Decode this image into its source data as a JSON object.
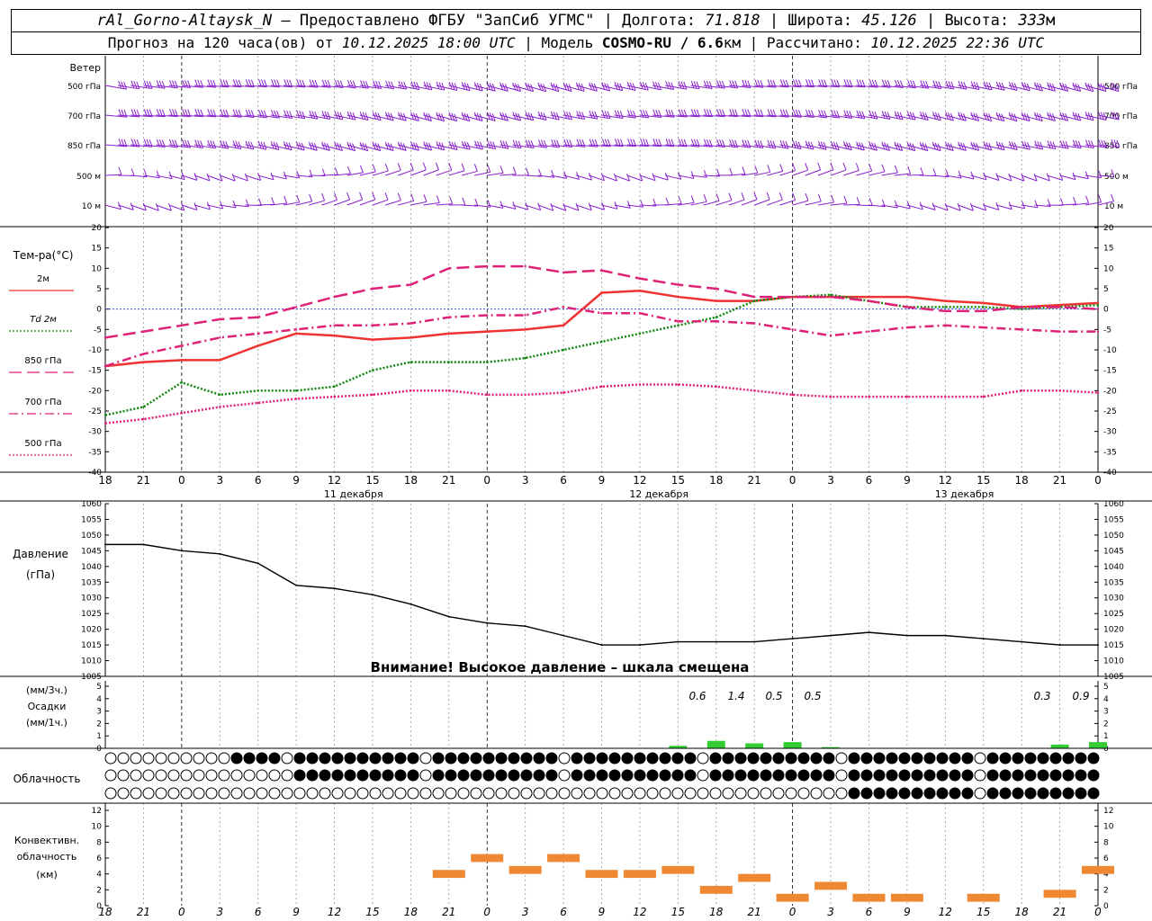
{
  "header": {
    "station": "rAl_Gorno-Altaysk_N",
    "provided_by": "– Предоставлено ФГБУ \"ЗапСиб УГМС\" |",
    "lon_label": "Долгота:",
    "lon": "71.818",
    "lat_label": "| Широта:",
    "lat": "45.126",
    "alt_label": "| Высота:",
    "alt": "333",
    "alt_unit": "м",
    "forecast_label": "Прогноз на 120 часа(ов) от",
    "forecast_from": "10.12.2025 18:00 UTC",
    "model_label": "| Модель",
    "model": "COSMO-RU / 6.6",
    "model_unit": "км",
    "computed_label": "| Рассчитано:",
    "computed": "10.12.2025 22:36 UTC"
  },
  "wind_panel": {
    "title": "Ветер",
    "levels": [
      "500 гПа",
      "700 гПа",
      "850 гПа",
      "500 м",
      "10 м"
    ]
  },
  "temp_panel": {
    "title": "Тем-ра(°С)",
    "legend": [
      {
        "label": "2м",
        "color": "#ee3333",
        "dash": "solid"
      },
      {
        "label": "Td 2м",
        "color": "#118811",
        "dash": "dotted"
      },
      {
        "label": "850 гПа",
        "color": "#dd2277",
        "dash": "long"
      },
      {
        "label": "700 гПа",
        "color": "#dd2277",
        "dash": "dashdot"
      },
      {
        "label": "500 гПа",
        "color": "#dd2277",
        "dash": "dotted"
      }
    ],
    "y_ticks": [
      "20",
      "15",
      "10",
      "5",
      "0",
      "-5",
      "-10",
      "-15",
      "-20",
      "-25",
      "-30",
      "-35",
      "-40"
    ]
  },
  "time_axis": {
    "hour_labels": [
      "18",
      "21",
      "0",
      "3",
      "6",
      "9",
      "12",
      "15",
      "18",
      "21",
      "0",
      "3",
      "6",
      "9",
      "12",
      "15",
      "18",
      "21",
      "0",
      "3",
      "6",
      "9",
      "12",
      "15",
      "18",
      "21",
      "0"
    ],
    "day_labels": [
      "11 декабря",
      "12 декабря",
      "13 декабря"
    ]
  },
  "pressure_panel": {
    "title": "Давление",
    "unit": "(гПа)",
    "y_ticks": [
      "1060",
      "1055",
      "1050",
      "1045",
      "1040",
      "1035",
      "1030",
      "1025",
      "1020",
      "1015",
      "1010",
      "1005"
    ],
    "warning": "Внимание! Высокое давление – шкала смещена"
  },
  "precip_panel": {
    "unit3": "(мм/3ч.)",
    "title": "Осадки",
    "unit1": "(мм/1ч.)",
    "y_ticks": [
      "5",
      "4",
      "3",
      "2",
      "1",
      "0"
    ],
    "totals": [
      "0.6",
      "1.4",
      "0.5",
      "0.5",
      "0.3",
      "0.9"
    ]
  },
  "cloud_panel": {
    "title": "Облачность"
  },
  "conv_panel": {
    "title1": "Конвективн.",
    "title2": "облачность",
    "unit": "(км)",
    "y_ticks": [
      "12",
      "10",
      "8",
      "6",
      "4",
      "2",
      "0"
    ]
  },
  "colors": {
    "wind": "#8822cc",
    "t2m": "#ee3333",
    "td": "#118811",
    "upper": "#dd2277",
    "zero_line": "#3344ee",
    "precip": "#33cc33",
    "conv": "#ee8833"
  },
  "chart_data": [
    {
      "type": "line",
      "title": "Тем-ра(°С)",
      "x": [
        "18",
        "21",
        "0",
        "3",
        "6",
        "9",
        "12",
        "15",
        "18",
        "21",
        "0",
        "3",
        "6",
        "9",
        "12",
        "15",
        "18",
        "21",
        "0",
        "3",
        "6",
        "9",
        "12",
        "15",
        "18",
        "21",
        "0"
      ],
      "ylim": [
        -40,
        20
      ],
      "series": [
        {
          "name": "2м",
          "values": [
            -14,
            -13,
            -12.5,
            -12.5,
            -9,
            -6,
            -6.5,
            -7.5,
            -7,
            -6,
            -5.5,
            -5,
            -4,
            4,
            4.5,
            3,
            2,
            2,
            3,
            3,
            3,
            3,
            2,
            1.5,
            0.5,
            1,
            1.5
          ]
        },
        {
          "name": "Td 2м",
          "values": [
            -26,
            -24,
            -18,
            -21,
            -20,
            -20,
            -19,
            -15,
            -13,
            -13,
            -13,
            -12,
            -10,
            -8,
            -6,
            -4,
            -2,
            2,
            3,
            3.5,
            2,
            0.5,
            0.5,
            0.5,
            0,
            0.5,
            1
          ]
        },
        {
          "name": "850 гПа",
          "values": [
            -7,
            -5.5,
            -4,
            -2.5,
            -2,
            0.5,
            3,
            5,
            6,
            10,
            10.5,
            10.5,
            9,
            9.5,
            7.5,
            6,
            5,
            3,
            3,
            3,
            2,
            0.5,
            -0.5,
            -0.5,
            0.5,
            0.5,
            0
          ]
        },
        {
          "name": "700 гПа",
          "values": [
            -14,
            -11,
            -9,
            -7,
            -6,
            -5,
            -4,
            -4,
            -3.5,
            -2,
            -1.5,
            -1.5,
            0.5,
            -1,
            -1,
            -3,
            -3,
            -3.5,
            -5,
            -6.5,
            -5.5,
            -4.5,
            -4,
            -4.5,
            -5,
            -5.5,
            -5.5
          ]
        },
        {
          "name": "500 гПа",
          "values": [
            -28,
            -27,
            -25.5,
            -24,
            -23,
            -22,
            -21.5,
            -21,
            -20,
            -20,
            -21,
            -21,
            -20.5,
            -19,
            -18.5,
            -18.5,
            -19,
            -20,
            -21,
            -21.5,
            -21.5,
            -21.5,
            -21.5,
            -21.5,
            -20,
            -20,
            -20.5
          ]
        }
      ]
    },
    {
      "type": "line",
      "title": "Давление",
      "x": [
        "18",
        "21",
        "0",
        "3",
        "6",
        "9",
        "12",
        "15",
        "18",
        "21",
        "0",
        "3",
        "6",
        "9",
        "12",
        "15",
        "18",
        "21",
        "0",
        "3",
        "6",
        "9",
        "12",
        "15",
        "18",
        "21",
        "0"
      ],
      "ylim": [
        1005,
        1060
      ],
      "series": [
        {
          "name": "Давление",
          "values": [
            1047,
            1047,
            1045,
            1044,
            1041,
            1034,
            1033,
            1031,
            1028,
            1024,
            1022,
            1021,
            1018,
            1015,
            1015,
            1016,
            1016,
            1016,
            1017,
            1018,
            1019,
            1018,
            1018,
            1017,
            1016,
            1015,
            1015
          ]
        }
      ]
    },
    {
      "type": "bar",
      "title": "Осадки",
      "x": [
        "18",
        "21",
        "0",
        "3",
        "6",
        "9",
        "12",
        "15",
        "18",
        "21",
        "0",
        "3",
        "6",
        "9",
        "12",
        "15",
        "18",
        "21",
        "0",
        "3",
        "6",
        "9",
        "12",
        "15",
        "18",
        "21",
        "0"
      ],
      "ylim": [
        0,
        5
      ],
      "series": [
        {
          "name": "мм/1ч",
          "values": [
            0,
            0,
            0,
            0,
            0,
            0,
            0,
            0,
            0,
            0,
            0,
            0,
            0,
            0,
            0,
            0.2,
            0.6,
            0.4,
            0.5,
            0.1,
            0,
            0,
            0,
            0,
            0,
            0.3,
            0.5
          ]
        }
      ]
    },
    {
      "type": "bar",
      "title": "Конвективн. облачность",
      "x": [
        "18",
        "21",
        "0",
        "3",
        "6",
        "9",
        "12",
        "15",
        "18",
        "21",
        "0",
        "3",
        "6",
        "9",
        "12",
        "15",
        "18",
        "21",
        "0",
        "3",
        "6",
        "9",
        "12",
        "15",
        "18",
        "21",
        "0"
      ],
      "ylim": [
        0,
        12
      ],
      "series": [
        {
          "name": "км",
          "values": [
            0,
            0,
            0,
            0,
            0,
            0,
            0,
            0,
            0,
            4.5,
            6.5,
            5,
            6.5,
            4.5,
            4.5,
            5,
            2.5,
            4,
            1.5,
            3,
            1.5,
            1.5,
            0,
            1.5,
            0,
            2,
            5
          ]
        }
      ]
    }
  ]
}
